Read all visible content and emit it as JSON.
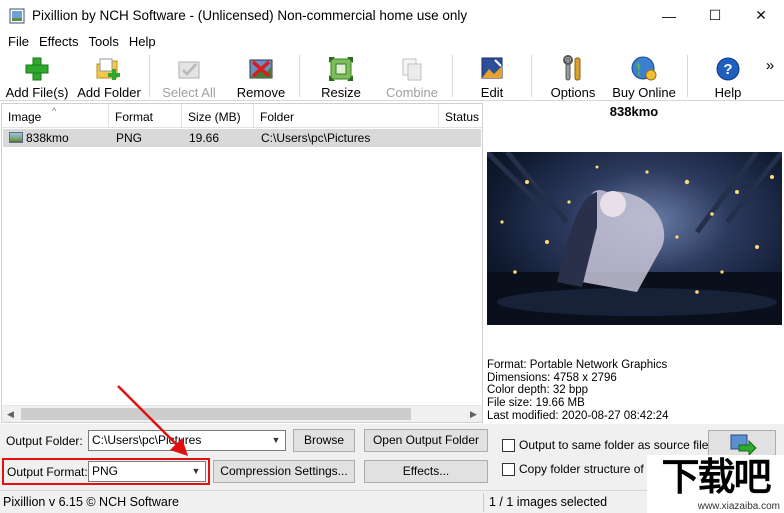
{
  "window": {
    "title": "Pixillion by NCH Software - (Unlicensed) Non-commercial home use only",
    "minimize": "—",
    "maximize": "☐",
    "close": "✕"
  },
  "menu": [
    "File",
    "Effects",
    "Tools",
    "Help"
  ],
  "toolbar": {
    "add_files": "Add File(s)",
    "add_folder": "Add Folder",
    "select_all": "Select All",
    "remove": "Remove",
    "resize": "Resize",
    "combine": "Combine",
    "edit": "Edit",
    "options": "Options",
    "buy_online": "Buy Online",
    "help": "Help",
    "more": "»"
  },
  "file_list": {
    "columns": [
      "Image",
      "Format",
      "Size (MB)",
      "Folder",
      "Status"
    ],
    "rows": [
      {
        "image": "838kmo",
        "format": "PNG",
        "size": "19.66",
        "folder": "C:\\Users\\pc\\Pictures",
        "status": ""
      }
    ]
  },
  "preview": {
    "name": "838kmo",
    "info": {
      "format": "Format: Portable Network Graphics",
      "dimensions": "Dimensions: 4758 x 2796",
      "color_depth": "Color depth: 32 bpp",
      "file_size": "File size: 19.66 MB",
      "last_modified": "Last modified: 2020-08-27 08:42:24"
    }
  },
  "output": {
    "folder_label": "Output Folder:",
    "folder_value": "C:\\Users\\pc\\Pictures",
    "browse": "Browse",
    "open_folder": "Open Output Folder",
    "format_label": "Output Format:",
    "format_value": "PNG",
    "compression": "Compression Settings...",
    "effects": "Effects...",
    "same_folder": "Output to same folder as source files",
    "copy_structure": "Copy folder structure of sou"
  },
  "status": {
    "version": "Pixillion v 6.15 © NCH Software",
    "selected": "1 / 1 images selected"
  },
  "watermark": {
    "text": "下载吧",
    "sub": "www.xiazaiba.com"
  },
  "colors": {
    "highlight": "#e01010",
    "arrow": "#e01010"
  }
}
